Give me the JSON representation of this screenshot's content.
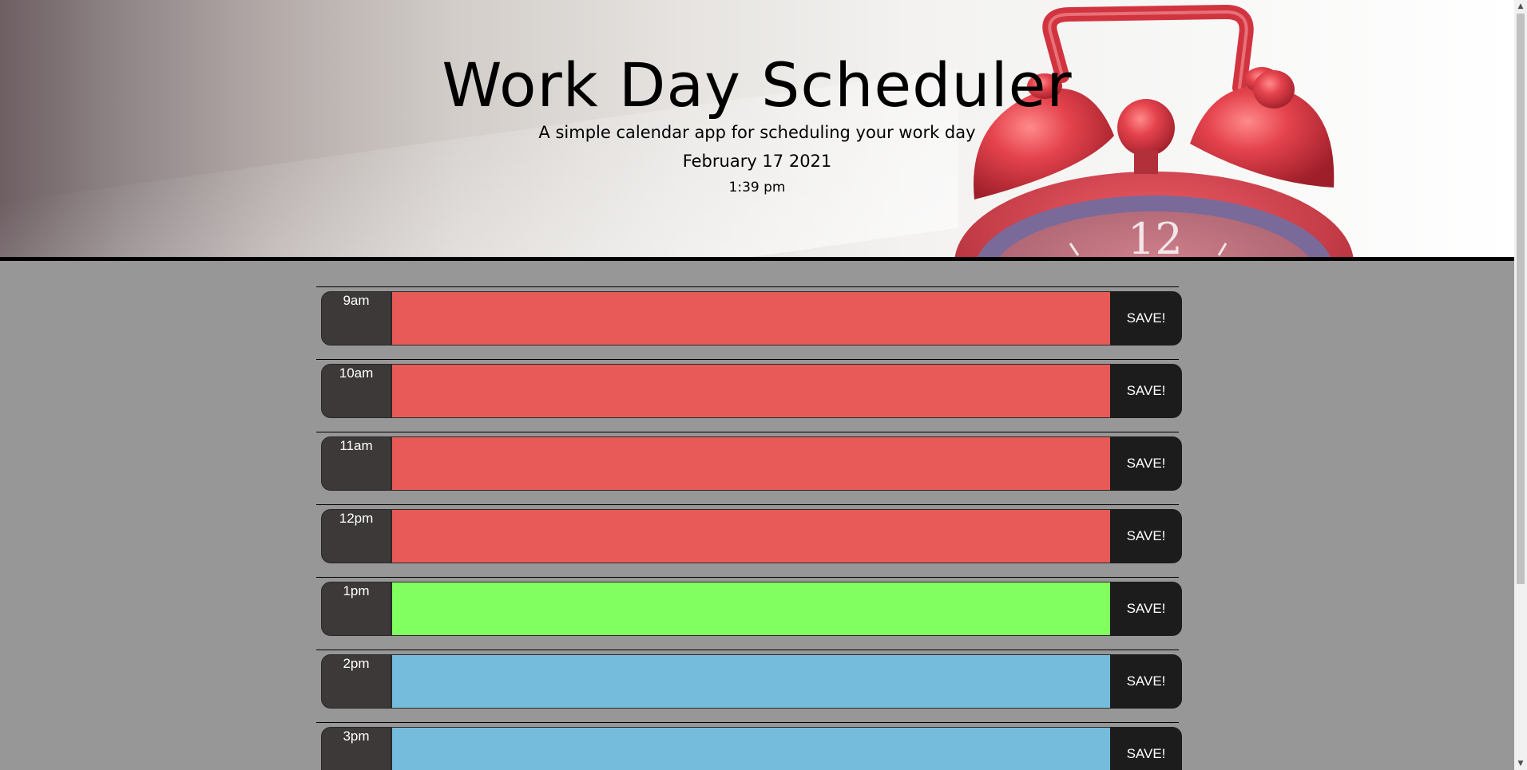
{
  "header": {
    "title": "Work Day Scheduler",
    "subtitle": "A simple calendar app for scheduling your work day",
    "date": "February 17 2021",
    "time": "1:39 pm"
  },
  "colors": {
    "past": "#e85a57",
    "present": "#81fe60",
    "future": "#75bcdc",
    "hour_block": "#3d3939",
    "save_button": "#1c1c1c",
    "page_background": "#979797"
  },
  "schedule": {
    "rows": [
      {
        "hour": "9am",
        "task": "",
        "status": "past",
        "save_label": "SAVE!"
      },
      {
        "hour": "10am",
        "task": "",
        "status": "past",
        "save_label": "SAVE!"
      },
      {
        "hour": "11am",
        "task": "",
        "status": "past",
        "save_label": "SAVE!"
      },
      {
        "hour": "12pm",
        "task": "",
        "status": "past",
        "save_label": "SAVE!"
      },
      {
        "hour": "1pm",
        "task": "",
        "status": "present",
        "save_label": "SAVE!"
      },
      {
        "hour": "2pm",
        "task": "",
        "status": "future",
        "save_label": "SAVE!"
      },
      {
        "hour": "3pm",
        "task": "",
        "status": "future",
        "save_label": "SAVE!"
      }
    ]
  },
  "icons": {
    "header_image": "alarm-clock-image",
    "scroll_up": "scroll-up-arrow-icon",
    "scroll_down": "scroll-down-arrow-icon"
  }
}
